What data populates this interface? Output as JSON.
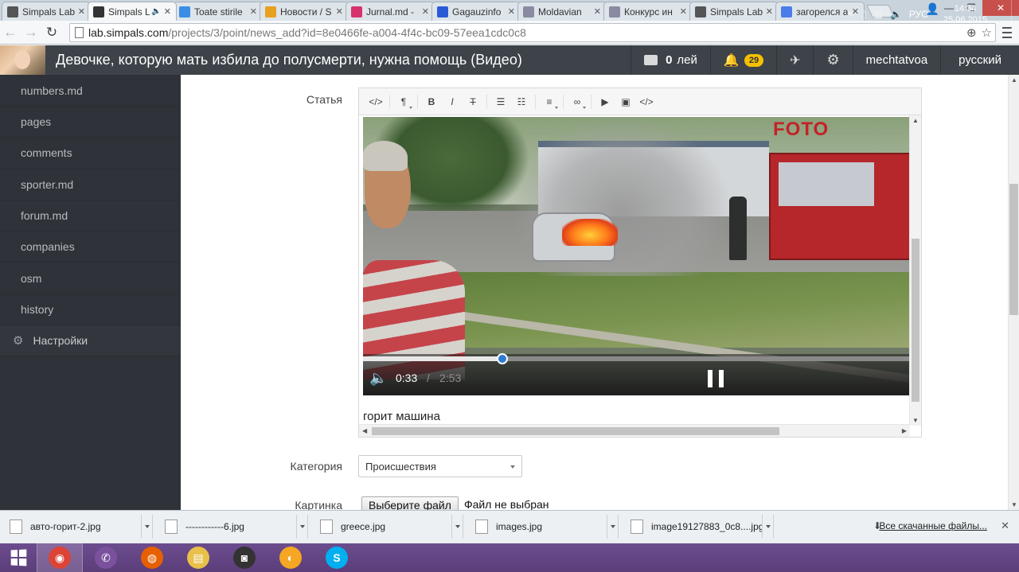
{
  "browser": {
    "tabs": [
      {
        "title": "Simpals Lab",
        "icon": "flask-icon",
        "color": "#555555",
        "active": false
      },
      {
        "title": "Simpals L",
        "icon": "flask-icon",
        "color": "#333333",
        "active": true,
        "audio": "🔈"
      },
      {
        "title": "Toate stirile",
        "icon": "grid-icon",
        "color": "#3a8ee6",
        "active": false
      },
      {
        "title": "Новости / S",
        "icon": "pencil-icon",
        "color": "#e8a020",
        "active": false
      },
      {
        "title": "Jurnal.md -",
        "icon": "j-icon",
        "color": "#d6336c",
        "active": false
      },
      {
        "title": "Gagauzinfo",
        "icon": "flag-icon",
        "color": "#2a5bd7",
        "active": false
      },
      {
        "title": "Moldavian",
        "icon": "m-icon",
        "color": "#8a8aa0",
        "active": false
      },
      {
        "title": "Конкурс ин",
        "icon": "m-icon",
        "color": "#8a8aa0",
        "active": false
      },
      {
        "title": "Simpals Lab",
        "icon": "flask-icon",
        "color": "#555555",
        "active": false
      },
      {
        "title": "загорелся а",
        "icon": "g-icon",
        "color": "#4a7de8",
        "active": false
      }
    ],
    "close_glyph": "✕",
    "url_host": "lab.simpals.com",
    "url_path": "/projects/3/point/news_add?id=8e0466fe-a004-4f4c-bc09-57eea1cdc0c8"
  },
  "header": {
    "title": "Девочке, которую мать избила до полусмерти, нужна помощь (Видео)",
    "balance_value": "0",
    "balance_unit": "лей",
    "notifications_count": "29",
    "username": "mechtatvoa",
    "language": "русский"
  },
  "sidebar": {
    "items": [
      {
        "label": "numbers.md"
      },
      {
        "label": "pages"
      },
      {
        "label": "comments"
      },
      {
        "label": "sporter.md"
      },
      {
        "label": "forum.md"
      },
      {
        "label": "companies"
      },
      {
        "label": "osm"
      },
      {
        "label": "history"
      }
    ],
    "settings_label": "Настройки"
  },
  "form": {
    "article_label": "Статья",
    "category_label": "Категория",
    "category_value": "Происшествия",
    "image_label": "Картинка",
    "file_button": "Выберите файл",
    "file_status": "Файл не выбран"
  },
  "editor": {
    "toolbar": [
      {
        "name": "html-source-icon",
        "glyph": "</>"
      },
      {
        "name": "paragraph-icon",
        "glyph": "¶",
        "dropdown": true
      },
      {
        "name": "bold-icon",
        "glyph": "B"
      },
      {
        "name": "italic-icon",
        "glyph": "I"
      },
      {
        "name": "strikethrough-icon",
        "glyph": "T"
      },
      {
        "name": "unordered-list-icon",
        "glyph": "☰"
      },
      {
        "name": "ordered-list-icon",
        "glyph": "☷"
      },
      {
        "name": "align-icon",
        "glyph": "≡",
        "dropdown": true
      },
      {
        "name": "link-icon",
        "glyph": "∞",
        "dropdown": true
      },
      {
        "name": "video-icon",
        "glyph": "▶"
      },
      {
        "name": "image-icon",
        "glyph": "▣"
      },
      {
        "name": "embed-code-icon",
        "glyph": "</>"
      }
    ],
    "caption": "горит машина",
    "video": {
      "sign_text": "FOTO",
      "current_time": "0:33",
      "separator": "/",
      "duration": "2:53",
      "progress_fraction": 0.255,
      "progress_color": "#2e7ad1"
    }
  },
  "downloads": {
    "items": [
      {
        "name": "авто-горит-2.jpg"
      },
      {
        "name": "------------6.jpg"
      },
      {
        "name": "greece.jpg"
      },
      {
        "name": "images.jpg"
      },
      {
        "name": "image19127883_0c8....jpg"
      }
    ],
    "show_all": "Все скачанные файлы..."
  },
  "taskbar": {
    "apps": [
      {
        "name": "chrome-icon",
        "glyph": "◉",
        "color": "#db4437",
        "active": true
      },
      {
        "name": "viber-icon",
        "glyph": "✆",
        "color": "#7b519d"
      },
      {
        "name": "firefox-icon",
        "glyph": "◍",
        "color": "#e66000"
      },
      {
        "name": "file-explorer-icon",
        "glyph": "▤",
        "color": "#e8c04a"
      },
      {
        "name": "camera-app-icon",
        "glyph": "◙",
        "color": "#333333"
      },
      {
        "name": "tray-app-icon",
        "glyph": "◐",
        "color": "#f5a623"
      },
      {
        "name": "skype-icon",
        "glyph": "S",
        "color": "#00aff0"
      }
    ],
    "language": "РУС",
    "time": "14:34",
    "date": "25.06.2015"
  }
}
